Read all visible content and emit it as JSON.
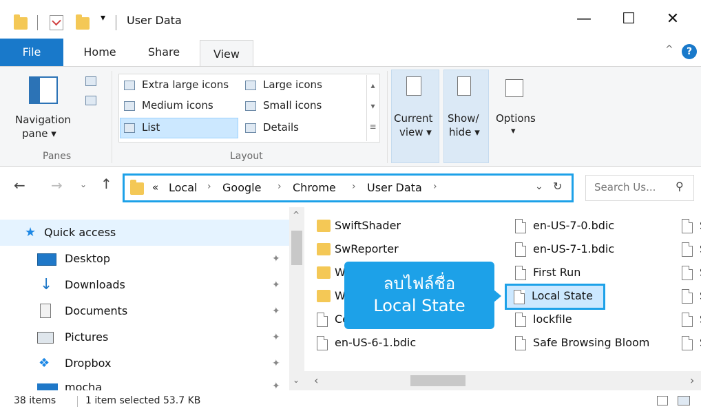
{
  "window": {
    "title": "User Data",
    "controls": {
      "minimize": "—",
      "maximize": "☐",
      "close": "✕"
    }
  },
  "ribbon": {
    "tabs": [
      {
        "label": "File"
      },
      {
        "label": "Home"
      },
      {
        "label": "Share"
      },
      {
        "label": "View"
      }
    ],
    "panes": {
      "navigation_pane_line1": "Navigation",
      "navigation_pane_line2": "pane ▾",
      "group_label": "Panes"
    },
    "layout": {
      "options": [
        "Extra large icons",
        "Large icons",
        "Medium icons",
        "Small icons",
        "List",
        "Details"
      ],
      "group_label": "Layout"
    },
    "current_view": {
      "line1": "Current",
      "line2": "view ▾"
    },
    "show_hide": {
      "line1": "Show/",
      "line2": "hide ▾"
    },
    "options": {
      "line1": "Options",
      "line2": "▾"
    }
  },
  "address": {
    "prefix": "«",
    "crumbs": [
      "Local",
      "Google",
      "Chrome",
      "User Data"
    ],
    "search_placeholder": "Search Us..."
  },
  "nav": {
    "quick_access": "Quick access",
    "items": [
      {
        "label": "Desktop"
      },
      {
        "label": "Downloads"
      },
      {
        "label": "Documents"
      },
      {
        "label": "Pictures"
      },
      {
        "label": "Dropbox"
      },
      {
        "label": "mocha"
      }
    ]
  },
  "files": {
    "col1": [
      "SwiftShader",
      "SwReporter",
      "W",
      "W",
      "Ce",
      "en-US-6-1.bdic"
    ],
    "col2": [
      "en-US-7-0.bdic",
      "en-US-7-1.bdic",
      "First Run",
      "Local State",
      "lockfile",
      "Safe Browsing Bloom"
    ],
    "col3": [
      "S",
      "S",
      "S",
      "S",
      "S",
      "S"
    ]
  },
  "callout": {
    "line1": "ลบไฟล์ชื่อ",
    "line2": "Local State"
  },
  "status": {
    "item_count": "38 items",
    "selection": "1 item selected  53.7 KB"
  },
  "colors": {
    "accent": "#1da1e8",
    "file_tab": "#1979ca",
    "folder": "#f4c856",
    "selection": "#cce8ff"
  }
}
